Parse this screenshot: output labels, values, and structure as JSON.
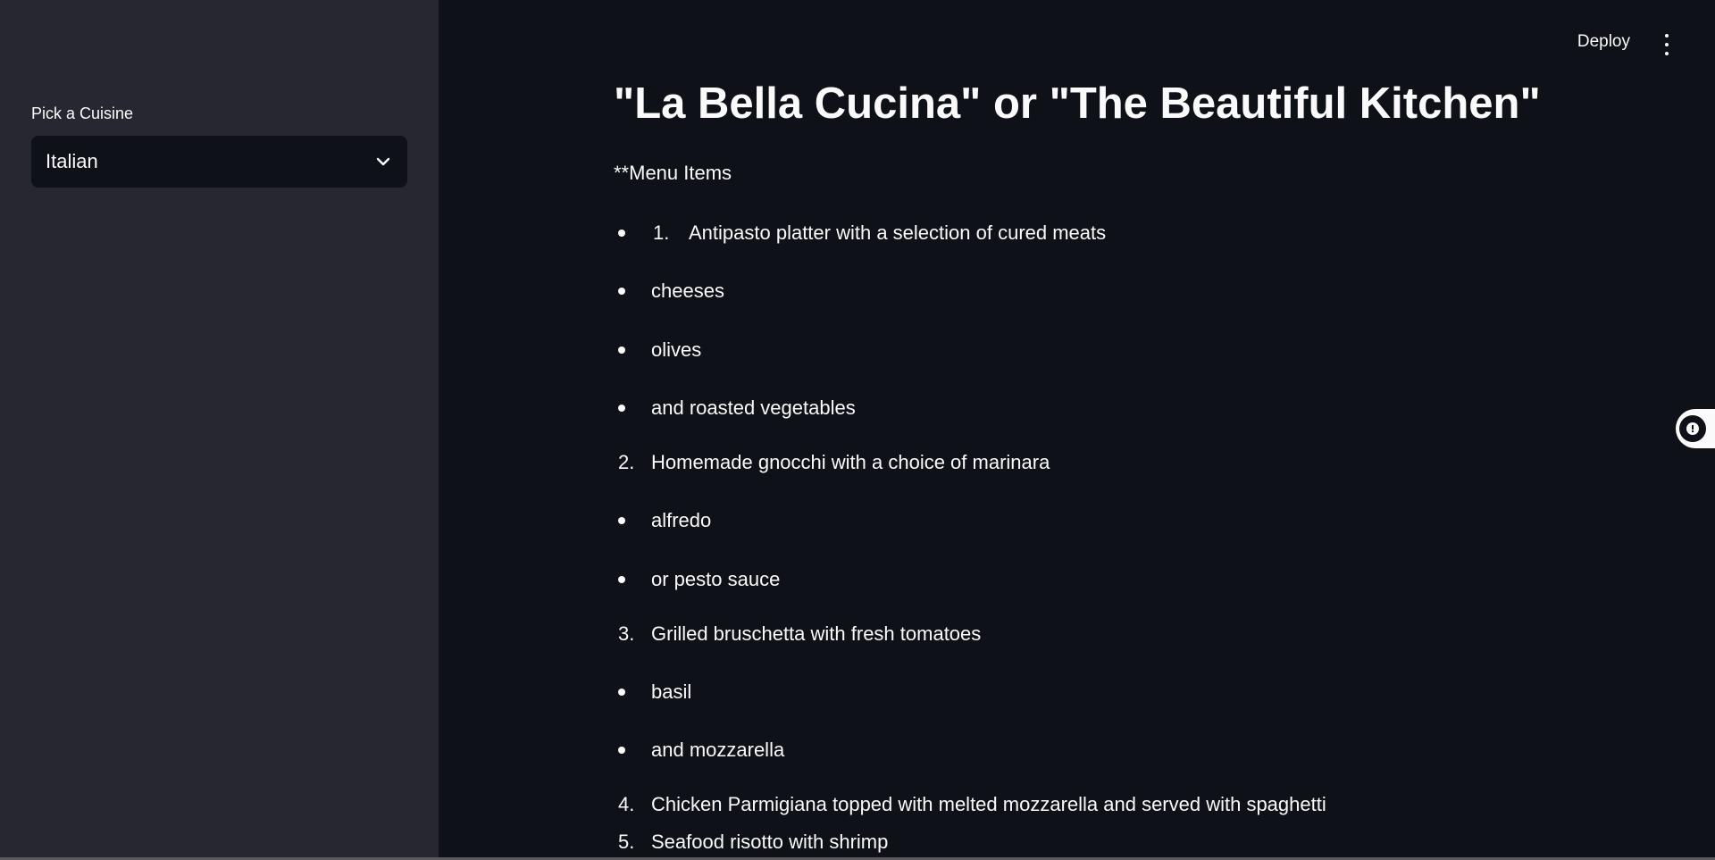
{
  "sidebar": {
    "select_label": "Pick a Cuisine",
    "select_value": "Italian"
  },
  "header": {
    "deploy_label": "Deploy"
  },
  "main": {
    "title": "\"La Bella Cucina\" or \"The Beautiful Kitchen\"",
    "intro": "**Menu Items",
    "items": [
      {
        "marker": "bullet",
        "inner_num": "1.",
        "text": "Antipasto platter with a selection of cured meats"
      },
      {
        "marker": "bullet",
        "text": "cheeses"
      },
      {
        "marker": "bullet",
        "text": "olives"
      },
      {
        "marker": "bullet",
        "text": "and roasted vegetables"
      },
      {
        "marker": "2.",
        "text": "Homemade gnocchi with a choice of marinara"
      },
      {
        "marker": "bullet",
        "text": "alfredo"
      },
      {
        "marker": "bullet",
        "text": "or pesto sauce"
      },
      {
        "marker": "3.",
        "text": "Grilled bruschetta with fresh tomatoes"
      },
      {
        "marker": "bullet",
        "text": "basil"
      },
      {
        "marker": "bullet",
        "text": "and mozzarella"
      },
      {
        "marker": "4.",
        "text": "Chicken Parmigiana topped with melted mozzarella and served with spaghetti"
      },
      {
        "marker": "5.",
        "text": "Seafood risotto with shrimp"
      }
    ]
  },
  "icons": {
    "dropdown": "chevron-down-icon",
    "menu": "kebab-menu-icon",
    "widget": "chat-widget-icon"
  },
  "colors": {
    "main_bg": "#0e1117",
    "sidebar_bg": "#262730",
    "text": "#fafafa"
  }
}
